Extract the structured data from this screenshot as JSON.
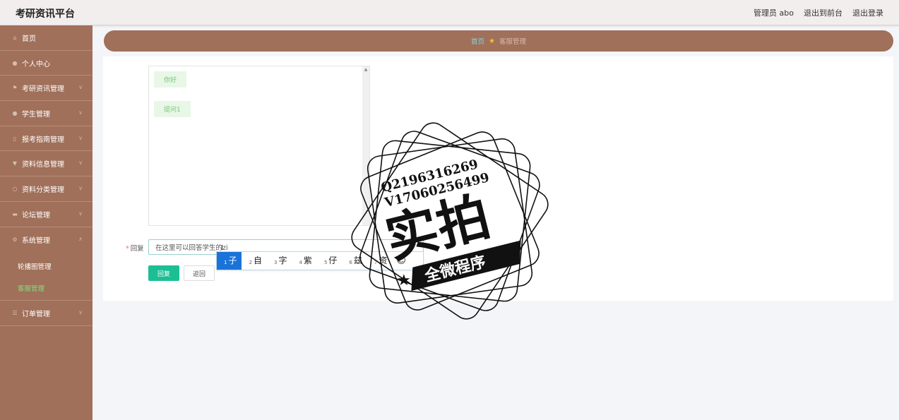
{
  "app": {
    "title": "考研资讯平台"
  },
  "topbar": {
    "user": "管理员 abo",
    "front_link": "退出到前台",
    "logout_link": "退出登录"
  },
  "sidebar": {
    "items": [
      {
        "label": "首页",
        "icon": "home-icon"
      },
      {
        "label": "个人中心",
        "icon": "user-icon"
      },
      {
        "label": "考研资讯管理",
        "icon": "flag-icon"
      },
      {
        "label": "学生管理",
        "icon": "user-icon"
      },
      {
        "label": "报考指南管理",
        "icon": "guide-icon"
      },
      {
        "label": "资料信息管理",
        "icon": "trophy-icon"
      },
      {
        "label": "资料分类管理",
        "icon": "circle-icon"
      },
      {
        "label": "论坛管理",
        "icon": "monitor-icon"
      },
      {
        "label": "系统管理",
        "icon": "gear-icon"
      }
    ],
    "system_submenu": [
      {
        "label": "轮播图管理"
      },
      {
        "label": "客服管理"
      }
    ],
    "order_item": {
      "label": "订单管理",
      "icon": "list-icon"
    }
  },
  "breadcrumb": {
    "home": "首页",
    "current": "客服管理"
  },
  "chat": {
    "messages": [
      "你好",
      "提问1"
    ]
  },
  "reply": {
    "label": "回复",
    "value": "在这里可以回答学生的zi",
    "reply_button": "回复",
    "back_button": "返回"
  },
  "ime": {
    "candidates": [
      {
        "num": "1",
        "char": "子"
      },
      {
        "num": "2",
        "char": "自"
      },
      {
        "num": "3",
        "char": "字"
      },
      {
        "num": "4",
        "char": "紫"
      },
      {
        "num": "5",
        "char": "仔"
      },
      {
        "num": "6",
        "char": "兹"
      },
      {
        "num": "7",
        "char": "资"
      }
    ],
    "emoji": "☺"
  },
  "watermark": {
    "line1": "Q2196316269",
    "line2": "V17060256499",
    "main": "实拍",
    "banner": "全微程序"
  },
  "colors": {
    "sidebar": "#a0705a",
    "primary_button": "#1cbf94",
    "active_menu": "#7fe07f",
    "ime_selected": "#1a73d8"
  }
}
